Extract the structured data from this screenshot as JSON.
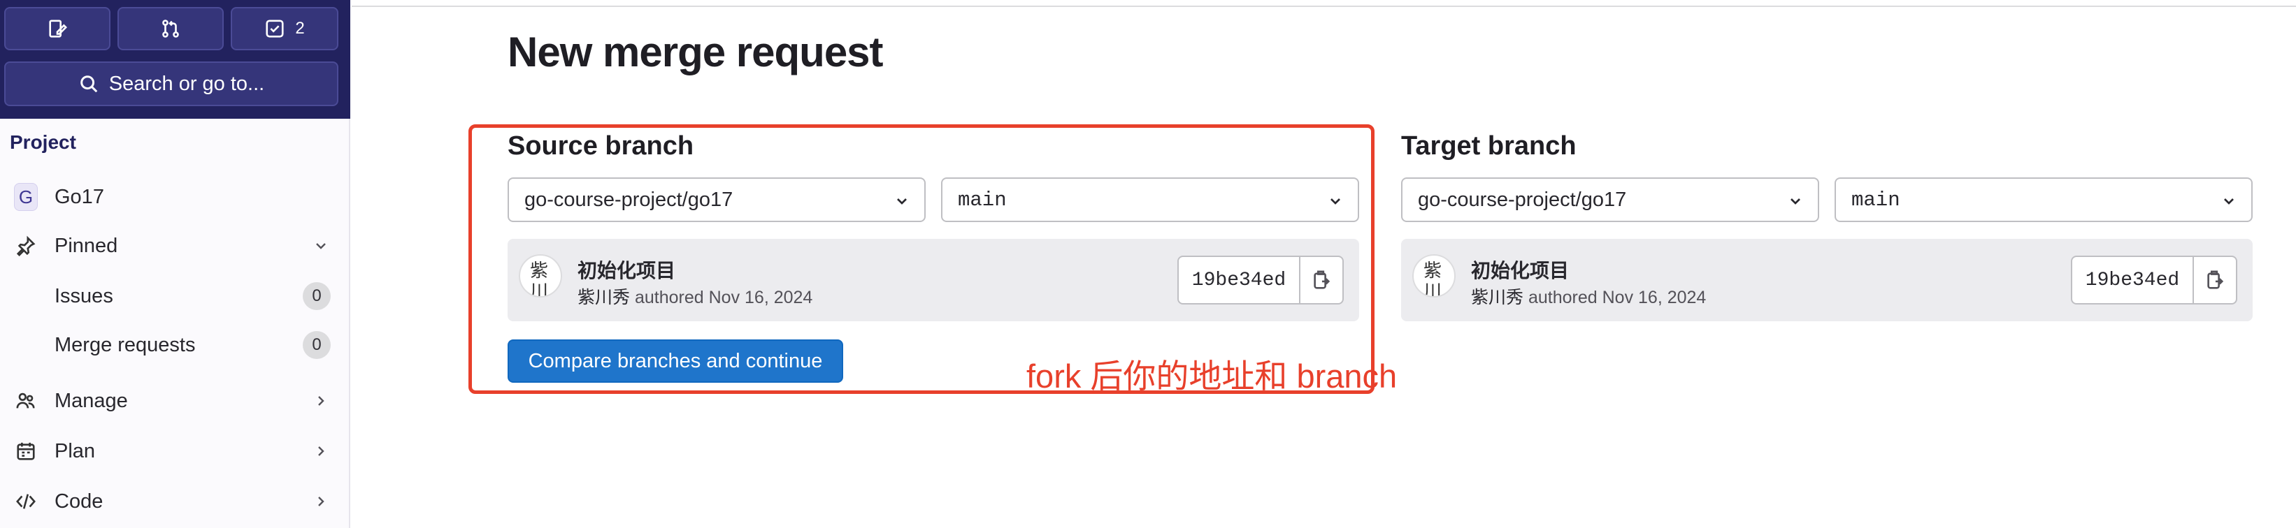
{
  "sidebar": {
    "top_buttons": [
      {
        "icon": "compose-icon",
        "label": ""
      },
      {
        "icon": "merge-request-icon",
        "label": ""
      },
      {
        "icon": "todo-checkbox-icon",
        "label": "2"
      }
    ],
    "search_label": "Search or go to...",
    "section_title": "Project",
    "project": {
      "avatar_letter": "G",
      "name": "Go17"
    },
    "items": [
      {
        "label": "Pinned",
        "icon": "pin-icon"
      },
      {
        "label": "Issues",
        "count": "0"
      },
      {
        "label": "Merge requests",
        "count": "0"
      },
      {
        "label": "Manage",
        "icon": "users-icon"
      },
      {
        "label": "Plan",
        "icon": "calendar-icon"
      },
      {
        "label": "Code",
        "icon": "code-icon"
      }
    ]
  },
  "page": {
    "title": "New merge request"
  },
  "source": {
    "title": "Source branch",
    "project_select": "go-course-project/go17",
    "branch_select": "main",
    "commit": {
      "avatar_alt": "紫川",
      "title": "初始化项目",
      "author": "紫川秀",
      "meta": "authored Nov 16, 2024",
      "sha": "19be34ed"
    }
  },
  "target": {
    "title": "Target branch",
    "project_select": "go-course-project/go17",
    "branch_select": "main",
    "commit": {
      "avatar_alt": "紫川",
      "title": "初始化项目",
      "author": "紫川秀",
      "meta": "authored Nov 16, 2024",
      "sha": "19be34ed"
    }
  },
  "actions": {
    "compare_label": "Compare branches and continue"
  },
  "annotation": {
    "text": "fork 后你的地址和 branch",
    "color": "#e8402b"
  },
  "colors": {
    "sidebar_header": "#22225e",
    "primary": "#1f75cb"
  }
}
